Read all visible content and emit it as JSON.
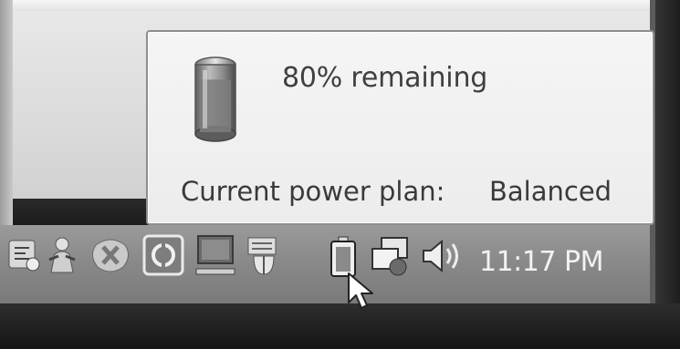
{
  "battery_flyout": {
    "status": "80% remaining",
    "plan_label": "Current power plan:",
    "plan_value": "Balanced",
    "charge_percent": 80
  },
  "taskbar": {
    "tray_icons": [
      "app-icon-1",
      "messenger-icon",
      "sync-icon",
      "media-icon",
      "monitor-icon",
      "shield-icon",
      "battery-icon",
      "network-icon",
      "volume-icon"
    ],
    "clock": "11:17 PM"
  }
}
